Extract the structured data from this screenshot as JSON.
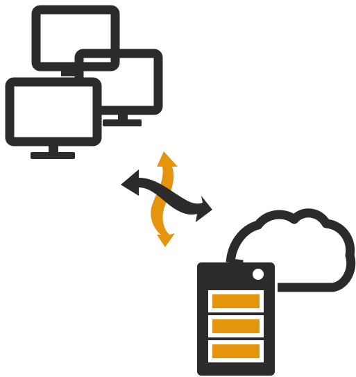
{
  "colors": {
    "dark": "#2b2b2b",
    "accent": "#e5940e",
    "background": "#ffffff"
  },
  "icons": {
    "monitors": [
      "monitor-icon",
      "monitor-icon",
      "monitor-icon"
    ],
    "sync": "sync-arrows-icon",
    "server": "server-icon",
    "cloud": "cloud-icon"
  }
}
